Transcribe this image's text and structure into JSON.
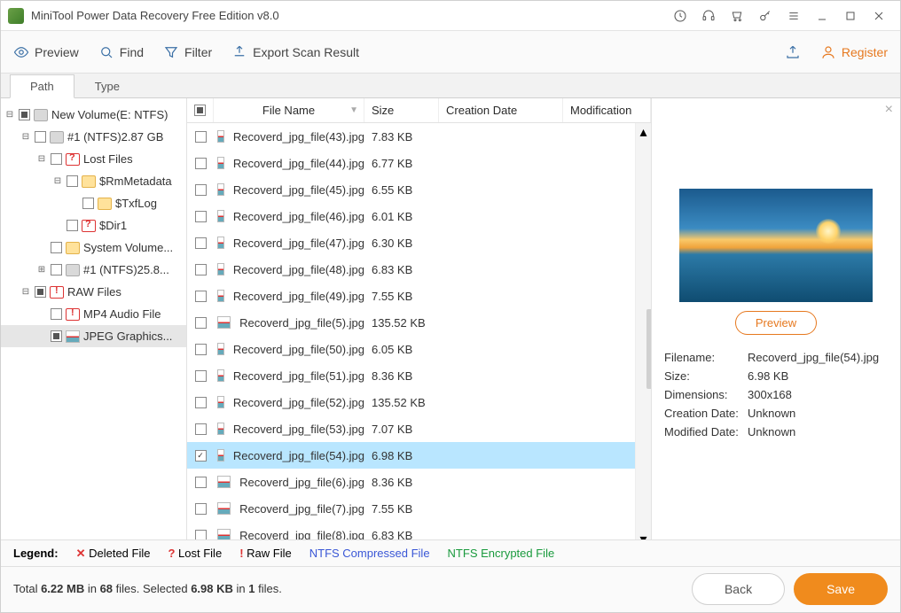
{
  "app": {
    "title": "MiniTool Power Data Recovery Free Edition v8.0"
  },
  "toolbar": {
    "preview": "Preview",
    "find": "Find",
    "filter": "Filter",
    "export": "Export Scan Result",
    "register": "Register"
  },
  "tabs": {
    "path": "Path",
    "type": "Type",
    "active": "path"
  },
  "tree": [
    {
      "depth": 0,
      "t": "m",
      "cb": "mixed",
      "icon": "drive",
      "label": "New Volume(E: NTFS)"
    },
    {
      "depth": 1,
      "t": "m",
      "cb": "",
      "icon": "drive",
      "label": "#1 (NTFS)2.87 GB"
    },
    {
      "depth": 2,
      "t": "m",
      "cb": "",
      "icon": "folderq",
      "label": "Lost Files"
    },
    {
      "depth": 3,
      "t": "m",
      "cb": "",
      "icon": "folder",
      "label": "$RmMetadata"
    },
    {
      "depth": 4,
      "t": "n",
      "cb": "",
      "icon": "folder",
      "label": "$TxfLog"
    },
    {
      "depth": 3,
      "t": "n",
      "cb": "",
      "icon": "folderq",
      "label": "$Dir1"
    },
    {
      "depth": 2,
      "t": "n",
      "cb": "",
      "icon": "folder",
      "label": "System Volume..."
    },
    {
      "depth": 2,
      "t": "p",
      "cb": "",
      "icon": "drive",
      "label": "#1 (NTFS)25.8..."
    },
    {
      "depth": 1,
      "t": "m",
      "cb": "mixed",
      "icon": "folderb",
      "label": "RAW Files"
    },
    {
      "depth": 2,
      "t": "n",
      "cb": "",
      "icon": "folderb",
      "label": "MP4 Audio File"
    },
    {
      "depth": 2,
      "t": "n",
      "cb": "mixed",
      "icon": "jpg",
      "label": "JPEG Graphics...",
      "sel": true
    }
  ],
  "columns": {
    "name": "File Name",
    "size": "Size",
    "cd": "Creation Date",
    "md": "Modification"
  },
  "files": [
    {
      "name": "Recoverd_jpg_file(43).jpg",
      "size": "7.83 KB"
    },
    {
      "name": "Recoverd_jpg_file(44).jpg",
      "size": "6.77 KB"
    },
    {
      "name": "Recoverd_jpg_file(45).jpg",
      "size": "6.55 KB"
    },
    {
      "name": "Recoverd_jpg_file(46).jpg",
      "size": "6.01 KB"
    },
    {
      "name": "Recoverd_jpg_file(47).jpg",
      "size": "6.30 KB"
    },
    {
      "name": "Recoverd_jpg_file(48).jpg",
      "size": "6.83 KB"
    },
    {
      "name": "Recoverd_jpg_file(49).jpg",
      "size": "7.55 KB"
    },
    {
      "name": "Recoverd_jpg_file(5).jpg",
      "size": "135.52 KB"
    },
    {
      "name": "Recoverd_jpg_file(50).jpg",
      "size": "6.05 KB"
    },
    {
      "name": "Recoverd_jpg_file(51).jpg",
      "size": "8.36 KB"
    },
    {
      "name": "Recoverd_jpg_file(52).jpg",
      "size": "135.52 KB"
    },
    {
      "name": "Recoverd_jpg_file(53).jpg",
      "size": "7.07 KB"
    },
    {
      "name": "Recoverd_jpg_file(54).jpg",
      "size": "6.98 KB",
      "sel": true,
      "checked": true
    },
    {
      "name": "Recoverd_jpg_file(6).jpg",
      "size": "8.36 KB"
    },
    {
      "name": "Recoverd_jpg_file(7).jpg",
      "size": "7.55 KB"
    },
    {
      "name": "Recoverd_jpg_file(8).jpg",
      "size": "6.83 KB"
    }
  ],
  "preview": {
    "button": "Preview",
    "fields": {
      "Filename:": "Recoverd_jpg_file(54).jpg",
      "Size:": "6.98 KB",
      "Dimensions:": "300x168",
      "Creation Date:": "Unknown",
      "Modified Date:": "Unknown"
    }
  },
  "legend": {
    "label": "Legend:",
    "deleted": "Deleted File",
    "lost": "Lost File",
    "raw": "Raw File",
    "ntfsc": "NTFS Compressed File",
    "ntfse": "NTFS Encrypted File"
  },
  "footer": {
    "text_a": "Total ",
    "size_total": "6.22 MB",
    "text_b": " in ",
    "files_total": "68",
    "text_c": " files.  Selected ",
    "size_sel": "6.98 KB",
    "text_d": " in ",
    "files_sel": "1",
    "text_e": " files.",
    "back": "Back",
    "save": "Save"
  }
}
